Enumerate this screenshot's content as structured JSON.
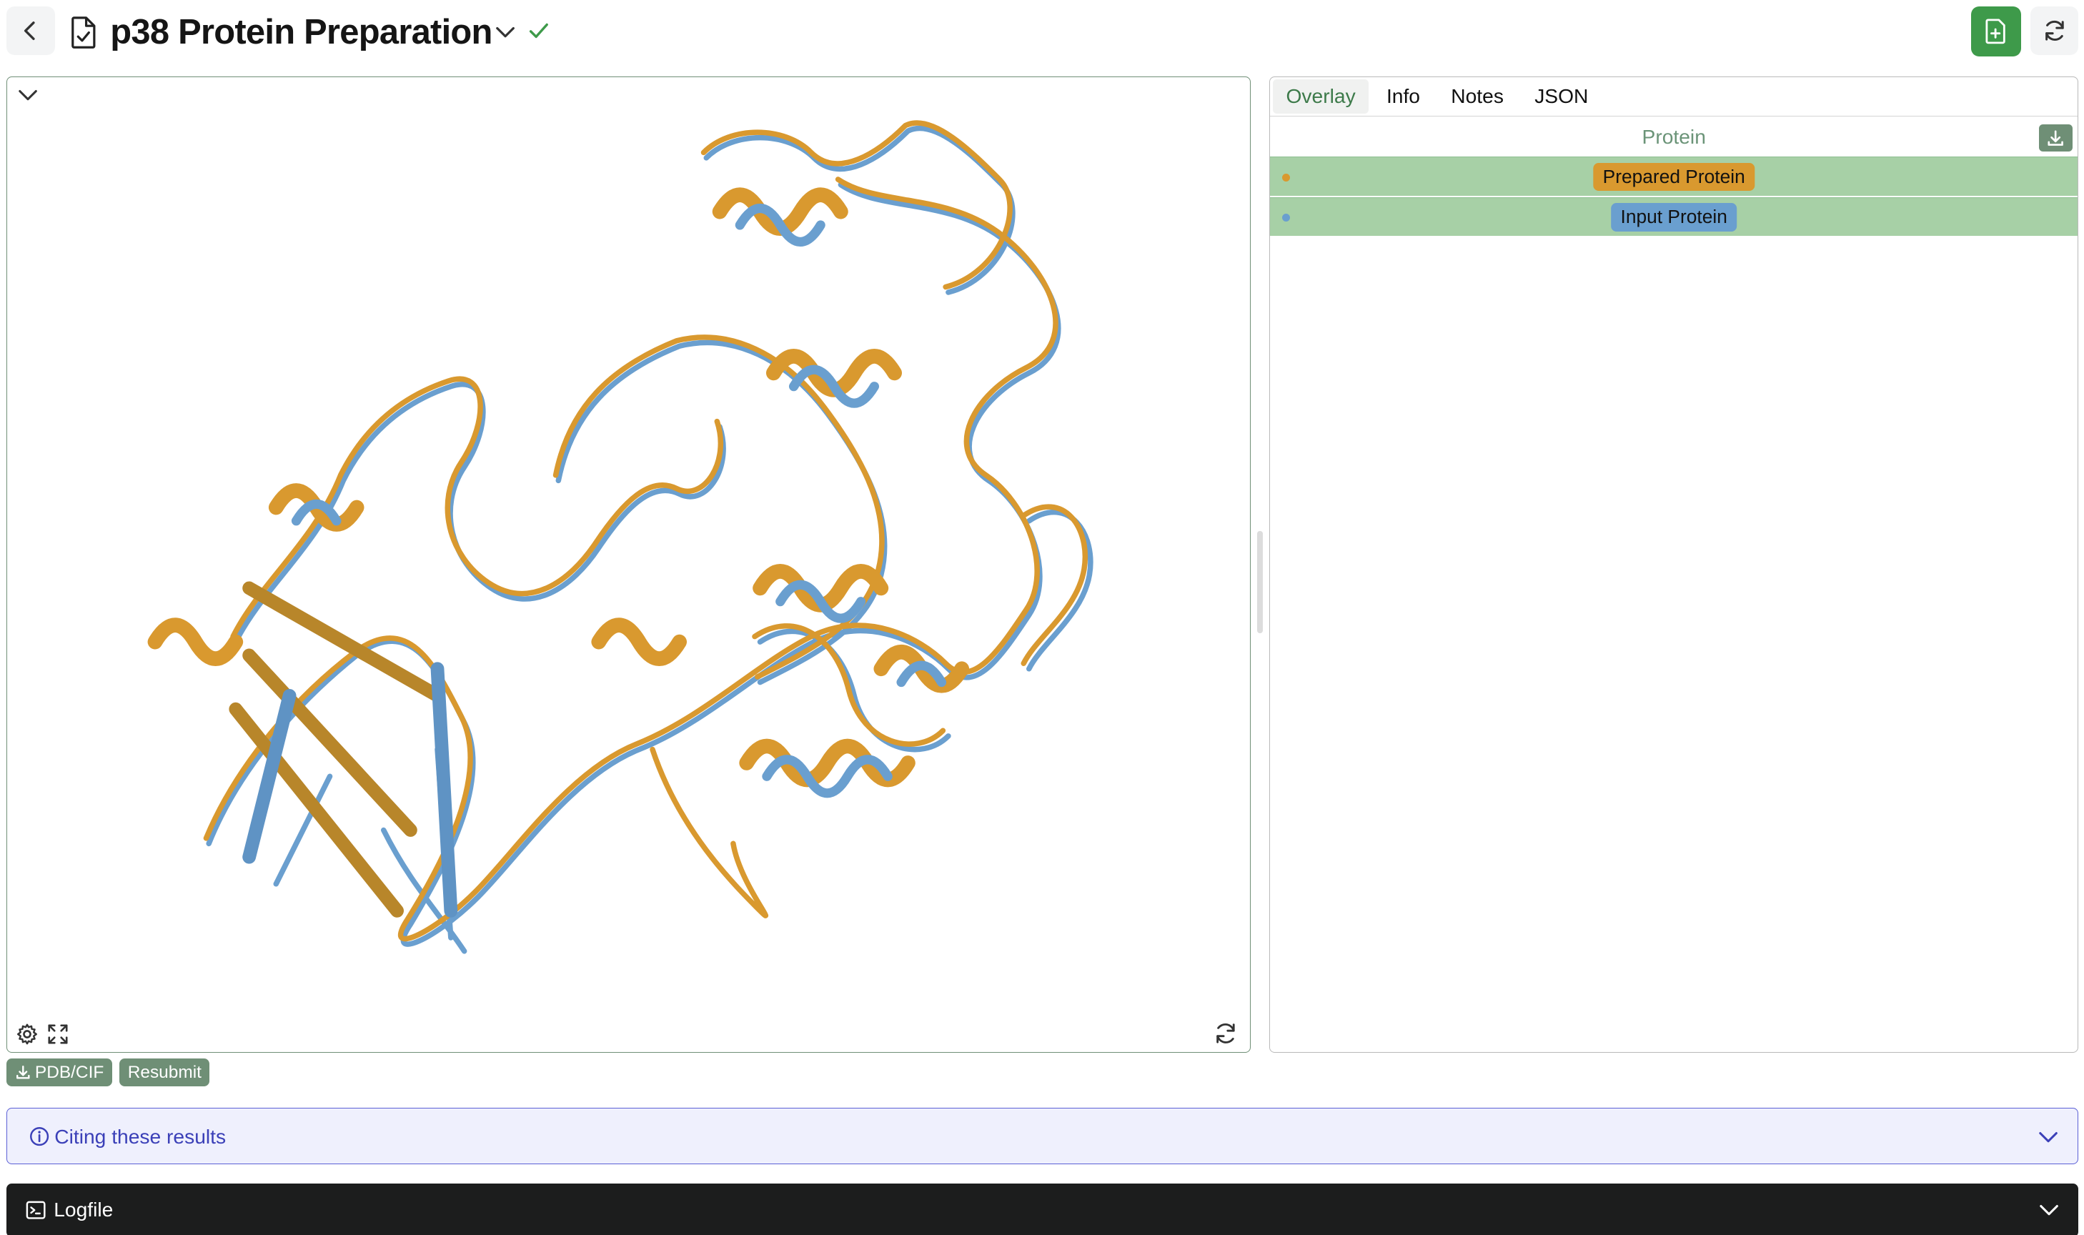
{
  "header": {
    "title": "p38 Protein Preparation",
    "status_icon": "check-icon",
    "back_icon": "chevron-left-icon",
    "new_icon": "file-plus-icon",
    "refresh_icon": "refresh-icon"
  },
  "viewer": {
    "collapse_icon": "chevron-down-icon",
    "settings_icon": "gear-icon",
    "expand_icon": "expand-icon",
    "reset_icon": "refresh-icon",
    "colors": {
      "prepared": "#d9992f",
      "input": "#6a9fcf"
    }
  },
  "panel": {
    "tabs": [
      {
        "label": "Overlay",
        "active": true
      },
      {
        "label": "Info",
        "active": false
      },
      {
        "label": "Notes",
        "active": false
      },
      {
        "label": "JSON",
        "active": false
      }
    ],
    "column_header": "Protein",
    "download_icon": "download-icon",
    "rows": [
      {
        "label": "Prepared Protein",
        "color": "#d9992f"
      },
      {
        "label": "Input Protein",
        "color": "#6a9fcf"
      }
    ]
  },
  "actions": {
    "download_label": "PDB/CIF",
    "resubmit_label": "Resubmit"
  },
  "citing": {
    "label": "Citing these results",
    "icon": "info-icon"
  },
  "logfile": {
    "label": "Logfile",
    "icon": "terminal-icon"
  },
  "colors": {
    "accent_green": "#3e9a4a",
    "button_green": "#6f8f76",
    "row_green": "#a7d0a6",
    "citing_blue": "#3b40b8",
    "log_bg": "#1c1d1d"
  }
}
